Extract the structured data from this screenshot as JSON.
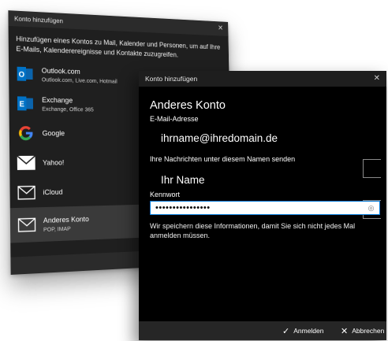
{
  "back_dialog": {
    "title": "Konto hinzufügen",
    "close_glyph": "✕",
    "intro": "Hinzufügen eines Kontos zu Mail, Kalender und Personen, um auf Ihre E-Mails, Kalenderereignisse und Kontakte zuzugreifen.",
    "accounts": [
      {
        "name": "Outlook.com",
        "sub": "Outlook.com, Live.com, Hotmail",
        "icon": "outlook-icon"
      },
      {
        "name": "Exchange",
        "sub": "Exchange, Office 365",
        "icon": "exchange-icon"
      },
      {
        "name": "Google",
        "sub": "",
        "icon": "google-icon"
      },
      {
        "name": "Yahoo!",
        "sub": "",
        "icon": "yahoo-envelope-icon"
      },
      {
        "name": "iCloud",
        "sub": "",
        "icon": "icloud-envelope-icon"
      },
      {
        "name": "Anderes Konto",
        "sub": "POP, IMAP",
        "icon": "other-account-envelope-icon"
      }
    ]
  },
  "front_dialog": {
    "title": "Konto hinzufügen",
    "close_glyph": "✕",
    "heading": "Anderes Konto",
    "email_label": "E-Mail-Adresse",
    "email_value": "ihrname@ihredomain.de",
    "name_label": "Ihre Nachrichten unter diesem Namen senden",
    "name_value": "Ihr Name",
    "password_label": "Kennwort",
    "password_value": "••••••••••••••••",
    "info_text": "Wir speichern diese Informationen, damit Sie sich nicht jedes Mal anmelden müssen.",
    "signin_label": "Anmelden",
    "cancel_label": "Abbrechen"
  },
  "colors": {
    "outlook_blue": "#0072c6",
    "exchange_blue": "#0072c6",
    "accent_blue": "#0078d7"
  }
}
